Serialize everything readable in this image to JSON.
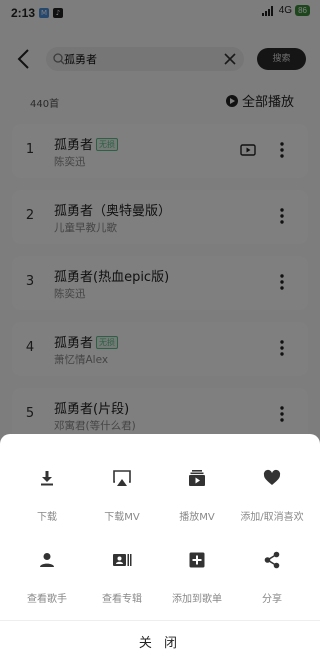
{
  "status_bar": {
    "time": "2:13",
    "network": "4G",
    "battery": "86"
  },
  "search": {
    "query": "孤勇者",
    "button_label": "搜索"
  },
  "list": {
    "count": "440首",
    "play_all_label": "全部播放"
  },
  "songs": [
    {
      "num": "1",
      "title": "孤勇者",
      "badge": "无损",
      "artist": "陈奕迅",
      "has_mv": true
    },
    {
      "num": "2",
      "title": "孤勇者（奥特曼版）",
      "badge": "",
      "artist": "儿童早教儿歌",
      "has_mv": false
    },
    {
      "num": "3",
      "title": "孤勇者(热血epic版)",
      "badge": "",
      "artist": "陈奕迅",
      "has_mv": false
    },
    {
      "num": "4",
      "title": "孤勇者",
      "badge": "无损",
      "artist": "萧忆情Alex",
      "has_mv": false
    },
    {
      "num": "5",
      "title": "孤勇者(片段)",
      "badge": "",
      "artist": "邓寓君(等什么君)",
      "has_mv": false
    }
  ],
  "sheet": {
    "actions": [
      {
        "label": "下载",
        "icon": "download-icon"
      },
      {
        "label": "下载MV",
        "icon": "airplay-icon"
      },
      {
        "label": "播放MV",
        "icon": "play-mv-icon"
      },
      {
        "label": "添加/取消喜欢",
        "icon": "heart-icon"
      },
      {
        "label": "查看歌手",
        "icon": "person-icon"
      },
      {
        "label": "查看专辑",
        "icon": "album-icon"
      },
      {
        "label": "添加到歌单",
        "icon": "add-playlist-icon"
      },
      {
        "label": "分享",
        "icon": "share-icon"
      }
    ],
    "close_label": "关 闭"
  }
}
